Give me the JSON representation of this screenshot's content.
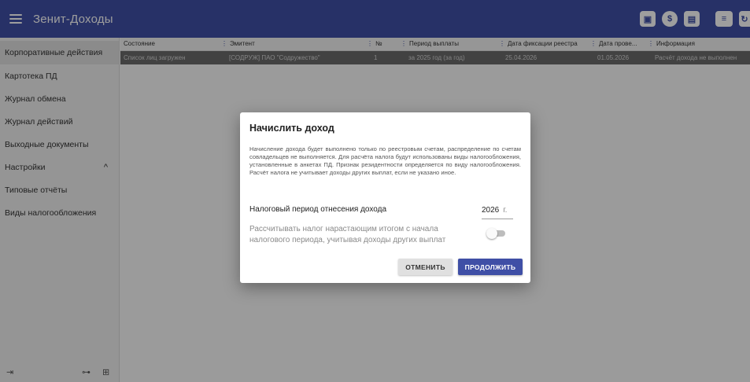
{
  "app": {
    "title": "Зенит-Доходы"
  },
  "sidebar": {
    "items": [
      {
        "label": "Корпоративные действия"
      },
      {
        "label": "Картотека ПД"
      },
      {
        "label": "Журнал обмена"
      },
      {
        "label": "Журнал действий"
      },
      {
        "label": "Выходные документы"
      },
      {
        "label": "Настройки",
        "chevron": "^"
      },
      {
        "label": "Типовые отчёты"
      },
      {
        "label": "Виды налогообложения"
      }
    ]
  },
  "table": {
    "columns": [
      "Состояние",
      "Эмитент",
      "№",
      "Период выплаты",
      "Дата фиксации реестра",
      "Дата прове...",
      "Информация"
    ],
    "rows": [
      [
        "Список лиц загружен",
        "[СОДРУЖ] ПАО \"Содружество\"",
        "1",
        "за 2025 год (за год)",
        "25.04.2026",
        "01.05.2026",
        "Расчёт дохода не выполнен"
      ]
    ]
  },
  "dialog": {
    "title": "Начислить доход",
    "text": "Начисление дохода будет выполнено только по реестровым счетам, распределение по счетам совладельцев не выполняется. Для расчёта налога будут использованы виды налогообложения, установленные в анкетах ПД. Признак резидентности определяется по виду налогообложения. Расчёт налога не учитывает доходы других выплат, если не указано иное.",
    "period_label": "Налоговый период отнесения дохода",
    "year": "2026",
    "year_unit": "г.",
    "switch_label": "Рассчитывать налог нарастающим итогом с начала налогового периода, учитывая доходы других выплат",
    "switch_on": false,
    "cancel_label": "ОТМЕНИТЬ",
    "ok_label": "ПРОДОЛЖИТЬ"
  },
  "colors": {
    "primary": "#3f4fa6",
    "row_selected": "#6b6b6b"
  }
}
